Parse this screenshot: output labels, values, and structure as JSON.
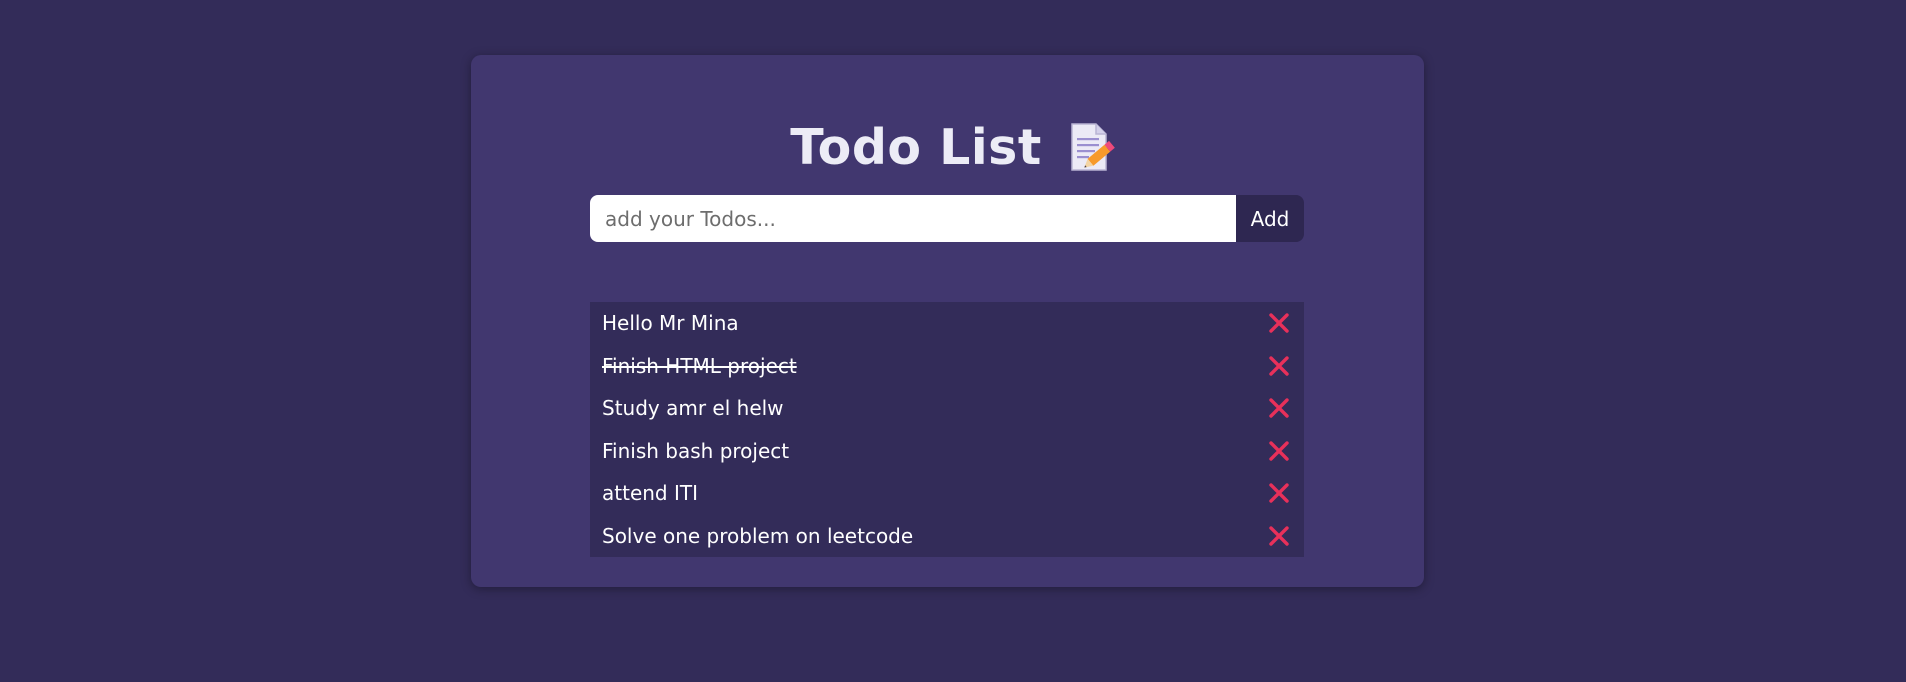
{
  "app": {
    "title": "Todo List",
    "title_icon": "memo-icon"
  },
  "form": {
    "placeholder": "add your Todos...",
    "value": "",
    "add_label": "Add"
  },
  "todos": [
    {
      "text": "Hello Mr Mina",
      "done": false
    },
    {
      "text": "Finish HTML project",
      "done": true
    },
    {
      "text": "Study amr el helw",
      "done": false
    },
    {
      "text": "Finish bash project",
      "done": false
    },
    {
      "text": "attend ITI",
      "done": false
    },
    {
      "text": "Solve one problem on leetcode",
      "done": false
    }
  ],
  "icons": {
    "delete": "close-icon"
  },
  "colors": {
    "page_background": "#332c59",
    "card_background": "#41376f",
    "list_background": "#332c59",
    "button_background": "#2e2751",
    "delete_icon": "#e8305a",
    "text": "#ffffff"
  }
}
